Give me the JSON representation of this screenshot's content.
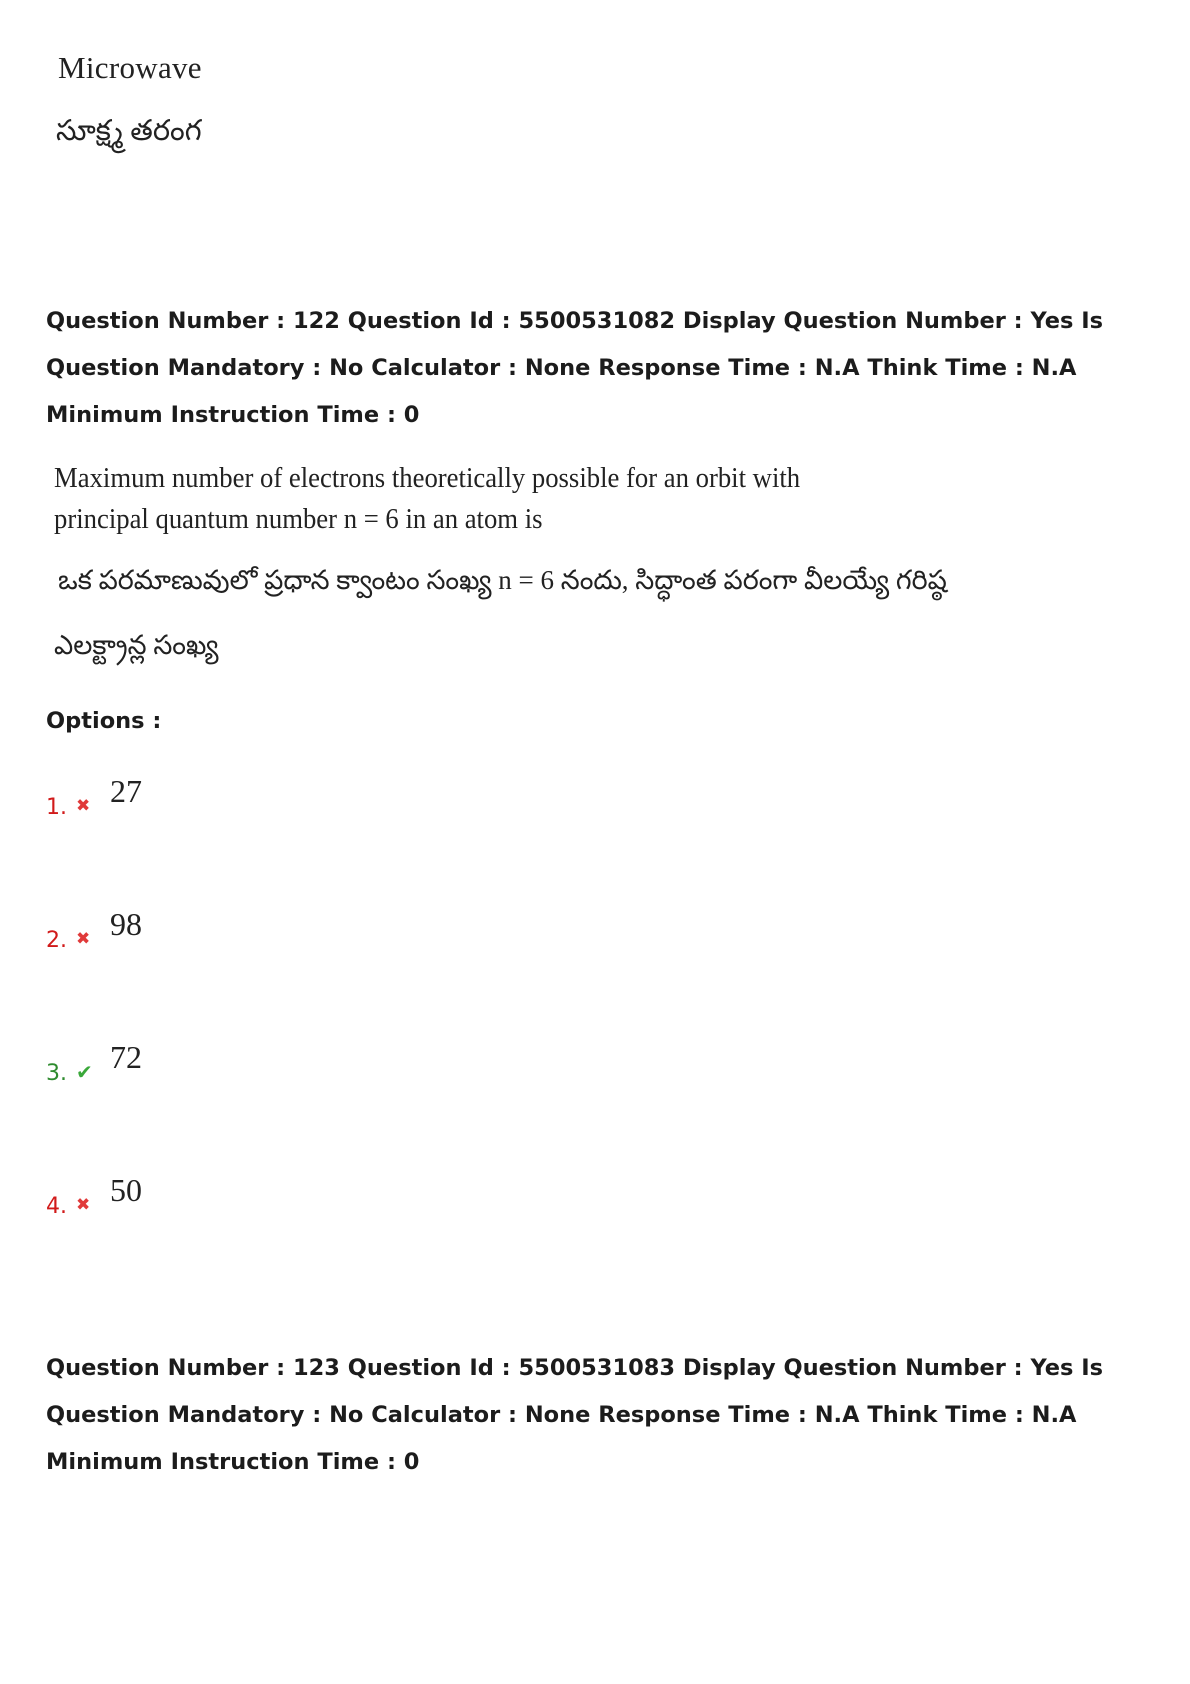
{
  "previous_answer": {
    "english": "Microwave",
    "telugu": "సూక్ష్మ తరంగ"
  },
  "question_122": {
    "meta": "Question Number : 122 Question Id : 5500531082 Display Question Number : Yes Is Question Mandatory : No Calculator : None Response Time : N.A Think Time : N.A Minimum Instruction Time : 0",
    "text_en": "Maximum number of electrons theoretically possible for an orbit with principal quantum number n = 6 in an atom is",
    "text_te_line1": "ఒక పరమాణువులో ప్రధాన క్వాంటం సంఖ్య n = 6 నందు, సిద్ధాంత పరంగా వీలయ్యే గరిష్ఠ",
    "text_te_line2": "ఎలక్ట్రాన్ల సంఖ్య",
    "options_label": "Options :",
    "options": [
      {
        "number": "1.",
        "value": "27",
        "status": "wrong",
        "icon": "cross-icon",
        "glyph": "✖"
      },
      {
        "number": "2.",
        "value": "98",
        "status": "wrong",
        "icon": "cross-icon",
        "glyph": "✖"
      },
      {
        "number": "3.",
        "value": "72",
        "status": "correct",
        "icon": "check-icon",
        "glyph": "✔"
      },
      {
        "number": "4.",
        "value": "50",
        "status": "wrong",
        "icon": "cross-icon",
        "glyph": "✖"
      }
    ]
  },
  "question_123": {
    "meta": "Question Number : 123 Question Id : 5500531083 Display Question Number : Yes Is Question Mandatory : No Calculator : None Response Time : N.A Think Time : N.A Minimum Instruction Time : 0"
  },
  "colors": {
    "wrong": "#d11a1a",
    "correct": "#2e8b2e",
    "text": "#1c1c1c"
  }
}
